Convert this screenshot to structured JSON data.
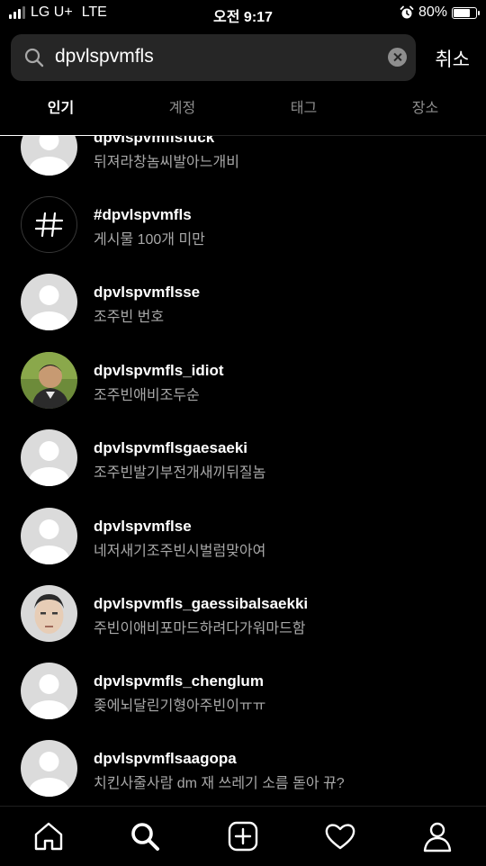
{
  "status_bar": {
    "carrier": "LG U+",
    "network": "LTE",
    "time": "오전 9:17",
    "battery_percent": "80%",
    "battery_level": 0.8
  },
  "search": {
    "query": "dpvlspvmfls",
    "cancel_label": "취소"
  },
  "tabs": [
    {
      "label": "인기",
      "active": true
    },
    {
      "label": "계정",
      "active": false
    },
    {
      "label": "태그",
      "active": false
    },
    {
      "label": "장소",
      "active": false
    }
  ],
  "results": [
    {
      "title": "dpvlspvmflsfuck",
      "subtitle": "뒤져라창놈씨발아느개비",
      "avatar": "default-avatar"
    },
    {
      "title": "#dpvlspvmfls",
      "subtitle": "게시물 100개 미만",
      "avatar": "hashtag-icon"
    },
    {
      "title": "dpvlspvmflsse",
      "subtitle": "조주빈 번호",
      "avatar": "default-avatar"
    },
    {
      "title": "dpvlspvmfls_idiot",
      "subtitle": "조주빈애비조두순",
      "avatar": "profile-photo"
    },
    {
      "title": "dpvlspvmflsgaesaeki",
      "subtitle": "조주빈발기부전개새끼뒤질놈",
      "avatar": "default-avatar"
    },
    {
      "title": "dpvlspvmflse",
      "subtitle": "네저새기조주빈시벌럼맞아여",
      "avatar": "default-avatar"
    },
    {
      "title": "dpvlspvmfls_gaessibalsaekki",
      "subtitle": "주빈이애비포마드하려다가워마드함",
      "avatar": "profile-photo"
    },
    {
      "title": "dpvlspvmfls_chenglum",
      "subtitle": "좆에뇌달린기형아주빈이ㅠㅠ",
      "avatar": "default-avatar"
    },
    {
      "title": "dpvlspvmflsaagopa",
      "subtitle": "치킨사줄사람 dm 재 쓰레기 소름 돋아 뀨?",
      "avatar": "default-avatar"
    }
  ],
  "bottom_nav": [
    {
      "icon": "home-icon",
      "active": false
    },
    {
      "icon": "search-icon",
      "active": true
    },
    {
      "icon": "add-post-icon",
      "active": false
    },
    {
      "icon": "heart-icon",
      "active": false
    },
    {
      "icon": "profile-icon",
      "active": false
    }
  ]
}
